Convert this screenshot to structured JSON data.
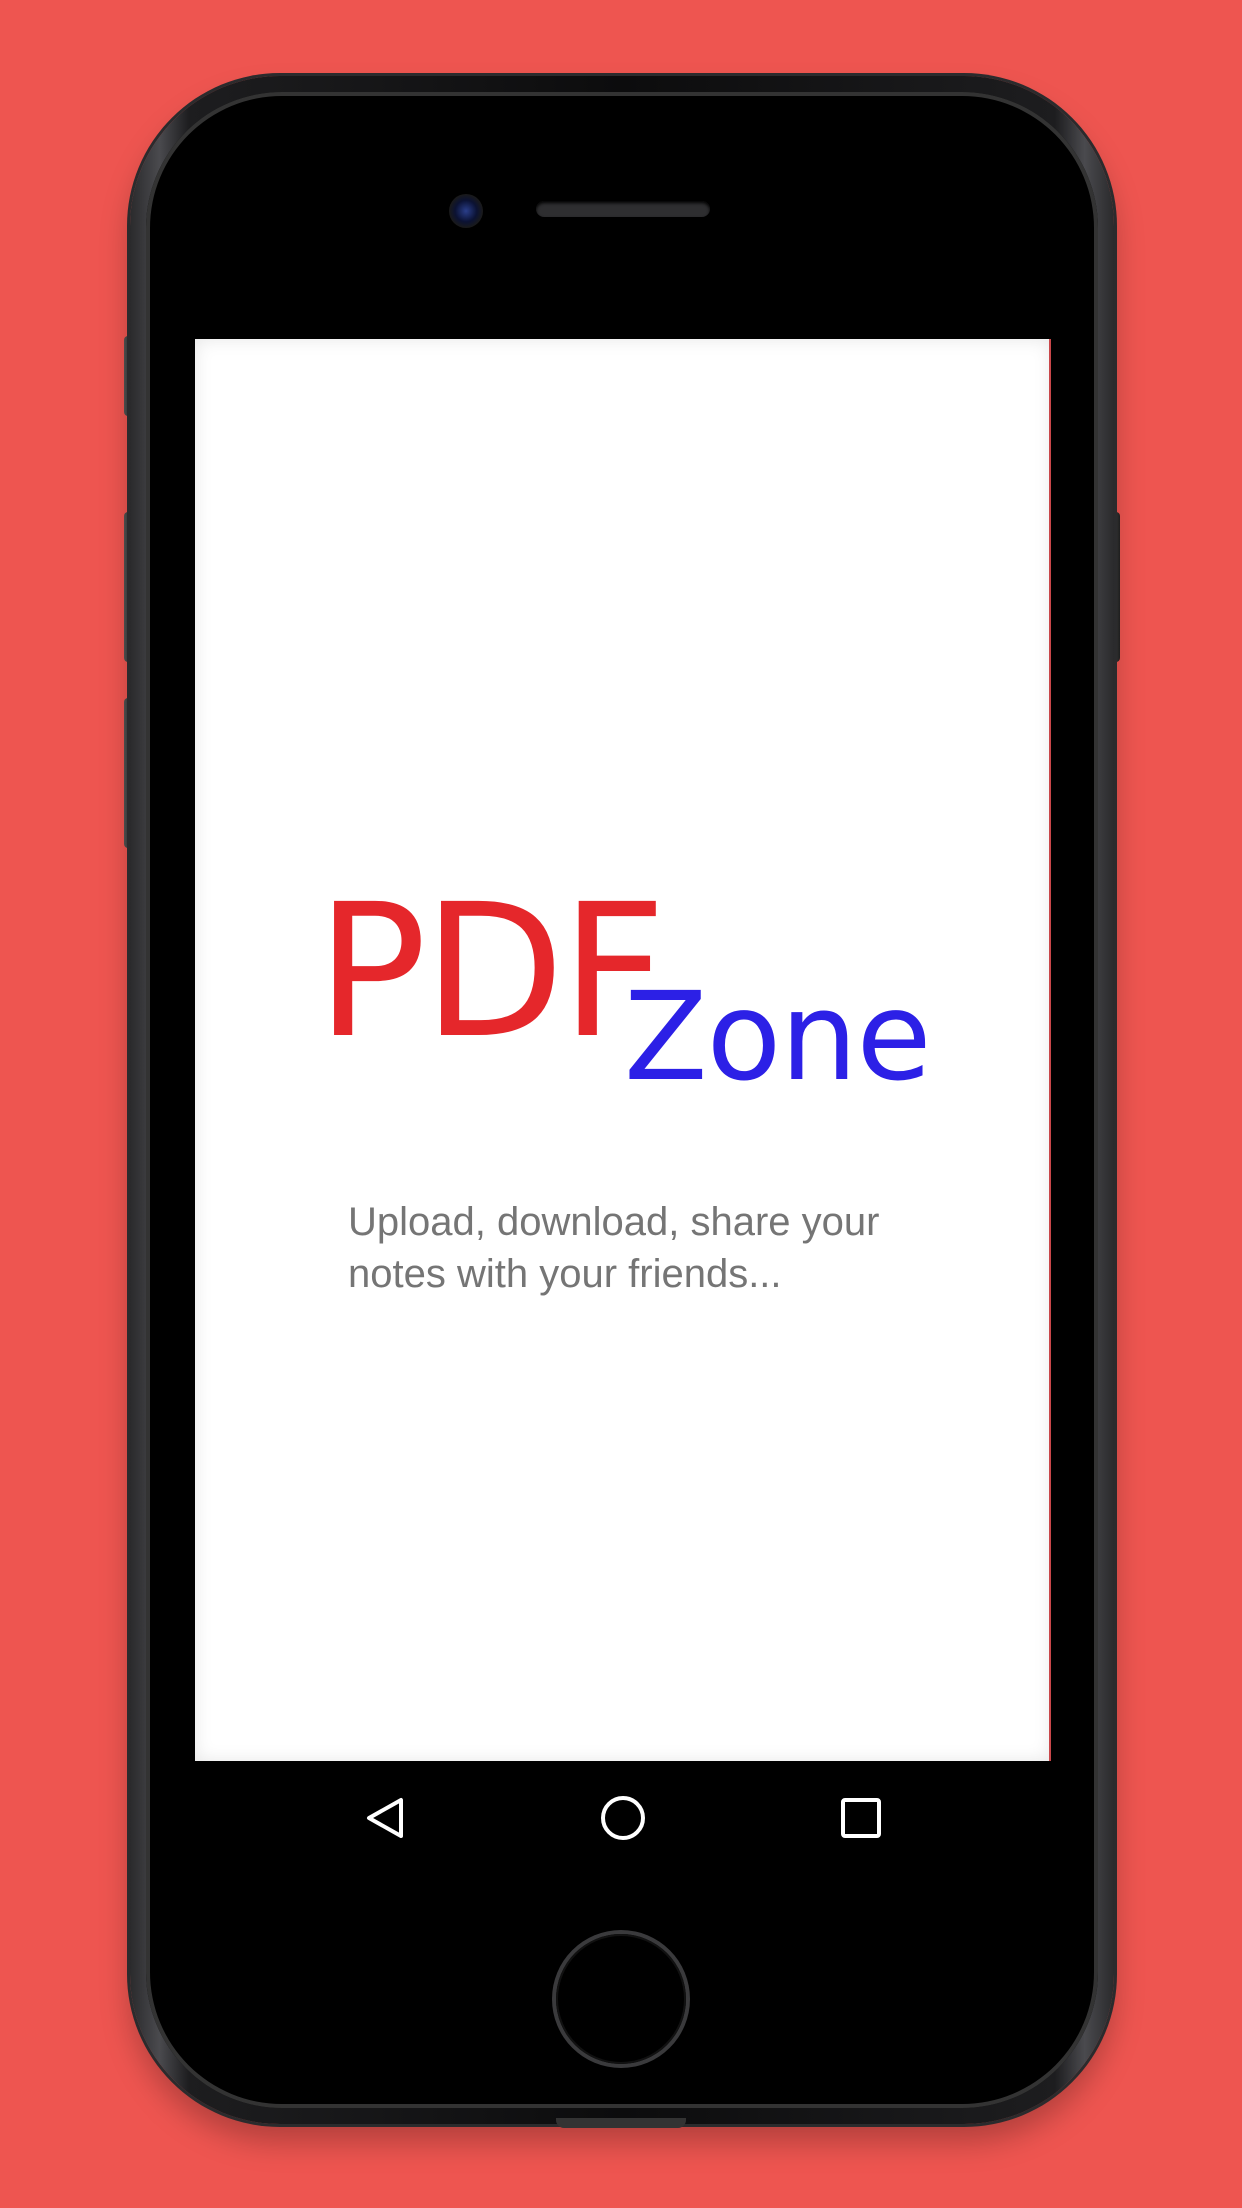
{
  "app": {
    "logo": {
      "primary": "PDF",
      "secondary": "Zone",
      "primary_color": "#e5272b",
      "secondary_color": "#2c20e6"
    },
    "tagline": "Upload, download, share your notes with your friends..."
  },
  "background_color": "#ee5550",
  "navigation": {
    "back_icon": "triangle-back-icon",
    "home_icon": "circle-home-icon",
    "recents_icon": "square-recents-icon"
  }
}
